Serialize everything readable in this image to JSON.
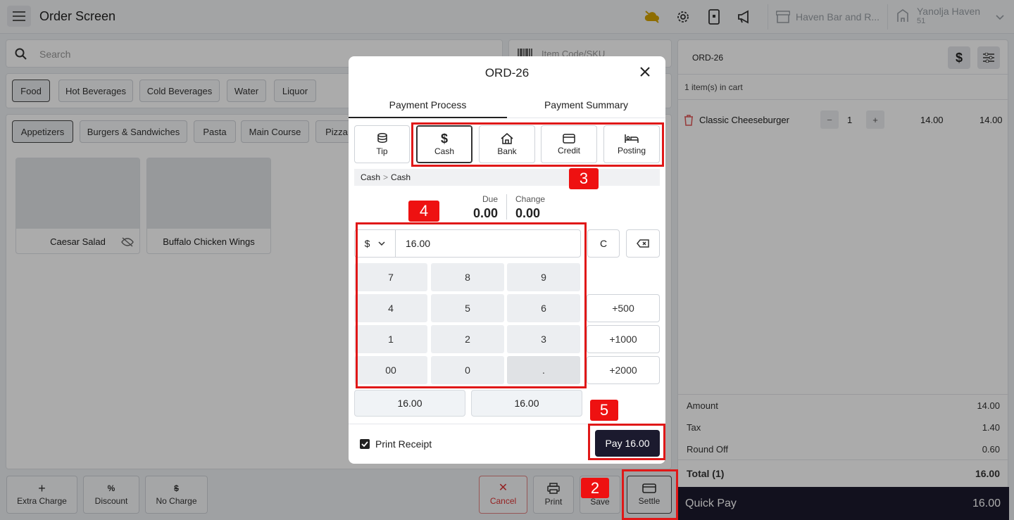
{
  "header": {
    "title": "Order Screen",
    "store_name": "Haven Bar and R...",
    "user_name": "Yanolja Haven",
    "user_id": "51"
  },
  "search": {
    "placeholder": "Search",
    "sku_placeholder": "Item Code/SKU"
  },
  "categories": [
    "Food",
    "Hot Beverages",
    "Cold Beverages",
    "Water",
    "Liquor"
  ],
  "subcategories": [
    "Appetizers",
    "Burgers & Sandwiches",
    "Pasta",
    "Main Course",
    "Pizza"
  ],
  "products": [
    "Caesar Salad",
    "Buffalo Chicken Wings"
  ],
  "bottom_actions": {
    "extra_charge": "Extra Charge",
    "discount": "Discount",
    "no_charge": "No Charge",
    "cancel": "Cancel",
    "print": "Print",
    "save": "Save",
    "settle": "Settle"
  },
  "cart": {
    "order_id": "ORD-26",
    "count_text": "1 item(s) in cart",
    "items": [
      {
        "name": "Classic Cheeseburger",
        "qty": "1",
        "price": "14.00",
        "total": "14.00"
      }
    ],
    "amount_label": "Amount",
    "amount": "14.00",
    "tax_label": "Tax",
    "tax": "1.40",
    "roundoff_label": "Round Off",
    "roundoff": "0.60",
    "total_label": "Total (1)",
    "total": "16.00",
    "quickpay_label": "Quick Pay",
    "quickpay": "16.00"
  },
  "modal": {
    "title": "ORD-26",
    "tabs": [
      "Payment Process",
      "Payment Summary"
    ],
    "methods": [
      "Tip",
      "Cash",
      "Bank",
      "Credit",
      "Posting"
    ],
    "breadcrumb_root": "Cash",
    "breadcrumb_sep": ">",
    "breadcrumb_leaf": "Cash",
    "due_label": "Due",
    "due": "0.00",
    "change_label": "Change",
    "change": "0.00",
    "currency": "$",
    "amount_value": "16.00",
    "clear_label": "C",
    "keys": [
      "7",
      "8",
      "9",
      "4",
      "5",
      "6",
      "1",
      "2",
      "3",
      "00",
      "0",
      "."
    ],
    "quick_add": [
      "+500",
      "+1000",
      "+2000"
    ],
    "suggest": [
      "16.00",
      "16.00"
    ],
    "print_receipt": "Print Receipt",
    "pay_label": "Pay 16.00"
  },
  "annotations": [
    "2",
    "3",
    "4",
    "5"
  ],
  "colors": {
    "accent_dark": "#1b1a2e",
    "highlight_red": "#e01818",
    "danger": "#d33"
  }
}
